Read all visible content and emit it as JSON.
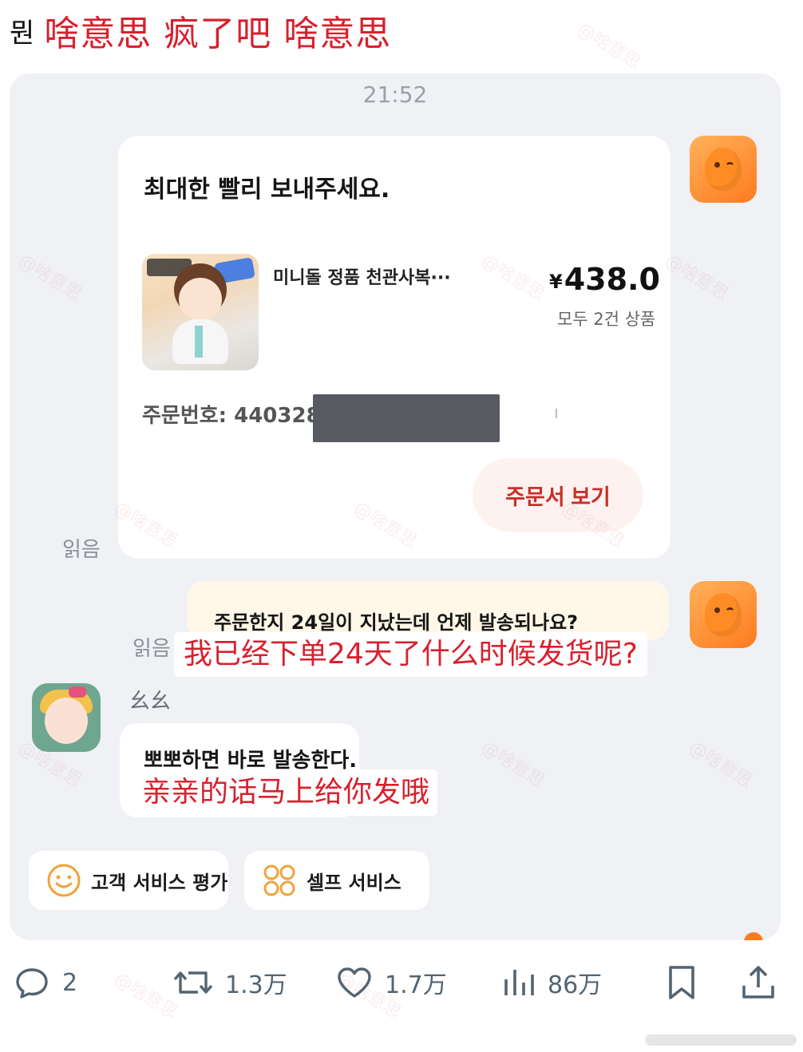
{
  "post": {
    "prefix": "뭔",
    "text": "啥意思 疯了吧 啥意思"
  },
  "chat": {
    "time": "21:52",
    "order_card": {
      "message": "최대한 빨리 보내주세요.",
      "product_name": "미니돌 정품 천관사복···",
      "price_symbol": "¥",
      "price": "438.0",
      "item_count": "모두 2건 상품",
      "order_number": "주문번호: 440328",
      "view_order_button": "주문서 보기"
    },
    "read_label_1": "읽음",
    "user_message": "주문한지 24일이 지났는데 언제 발송되나요?",
    "read_label_2": "읽음",
    "user_message_translation": "我已经下单24天了什么时候发货呢?",
    "rep_name": "幺幺",
    "rep_message": "뽀뽀하면 바로 발송한다.",
    "rep_message_translation": "亲亲的话马上给你发哦",
    "chips": [
      {
        "label": "고객 서비스 평가",
        "icon": "smiley-icon"
      },
      {
        "label": "셀프 서비스",
        "icon": "grid-icon"
      }
    ]
  },
  "actions": {
    "replies": "2",
    "reposts": "1.3万",
    "likes": "1.7万",
    "views": "86万"
  },
  "colors": {
    "annotation_red": "#d8202e",
    "chat_background": "#eff1f5",
    "accent_orange": "#ff7a1f",
    "action_gray": "#536471"
  }
}
